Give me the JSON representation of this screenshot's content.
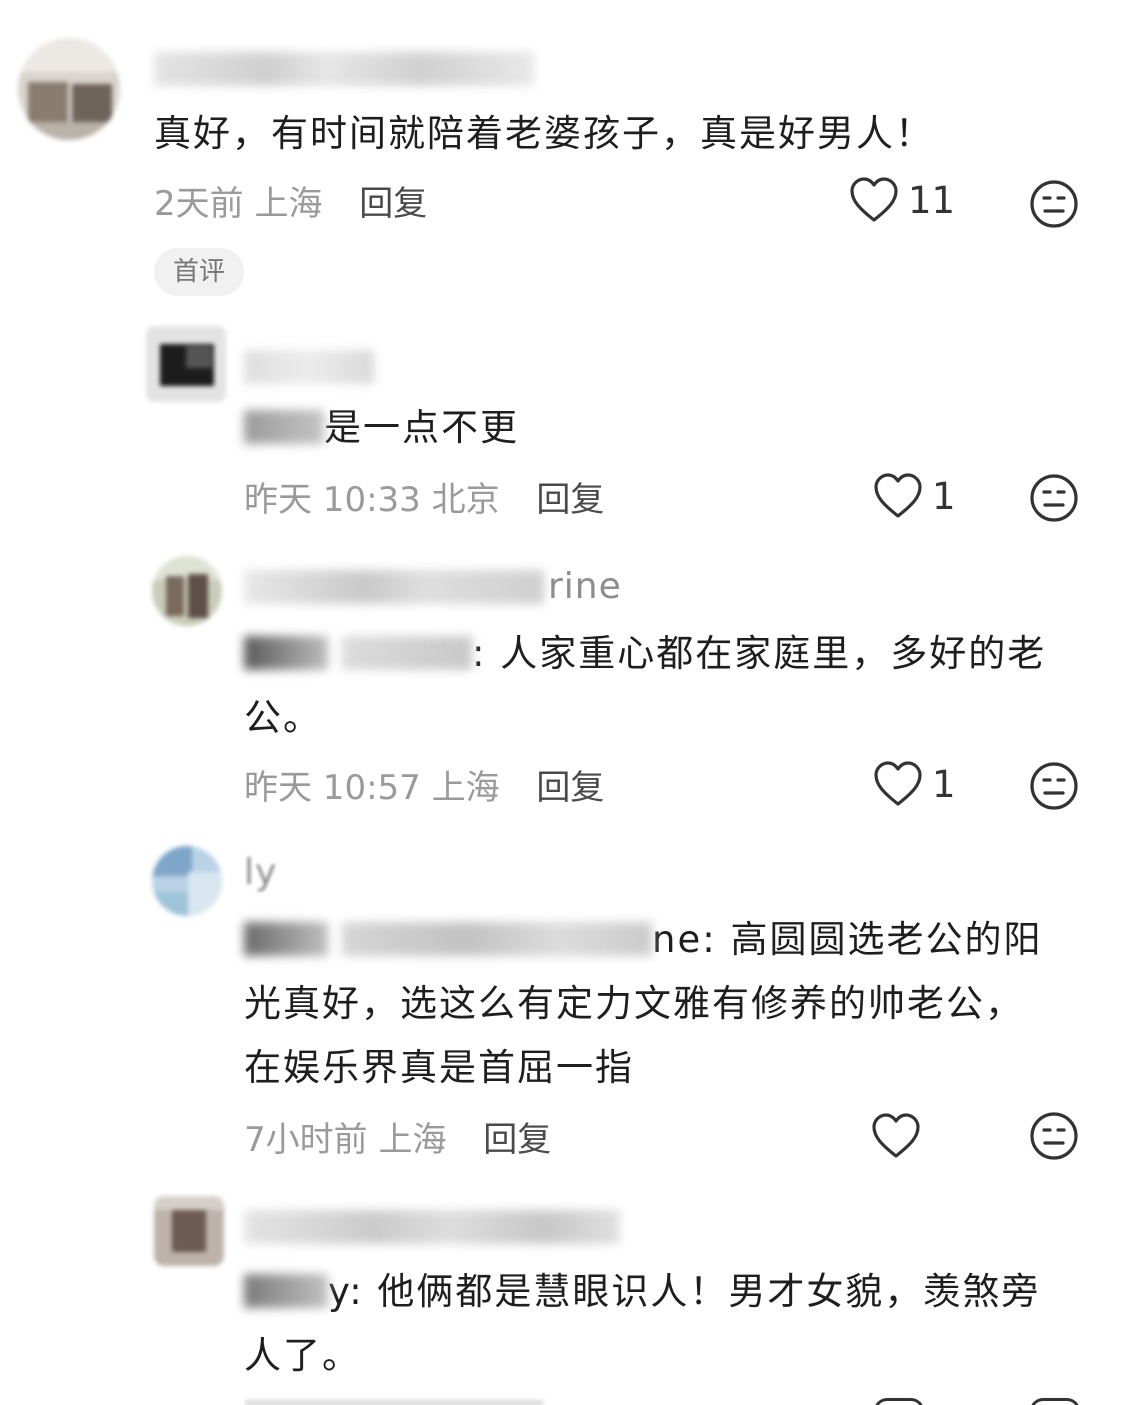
{
  "comments": [
    {
      "text": "真好，有时间就陪着老婆孩子，真是好男人！",
      "time": "2天前",
      "location": "上海",
      "reply_label": "回复",
      "likes": "11",
      "badge": "首评"
    },
    {
      "text_suffix": "是一点不更",
      "time": "昨天 10:33",
      "location": "北京",
      "reply_label": "回复",
      "likes": "1"
    },
    {
      "name_suffix": "rine",
      "text_line1": ": 人家重心都在家庭里，多好的老",
      "text_line2": "公。",
      "time": "昨天 10:57",
      "location": "上海",
      "reply_label": "回复",
      "likes": "1"
    },
    {
      "name_prefix": "ly",
      "text_line1_tail": "ne: 高圆圆选老公的阳",
      "text_line2": "光真好，选这么有定力文雅有修养的帅老公，",
      "text_line3": "在娱乐界真是首屈一指",
      "time": "7小时前",
      "location": "上海",
      "reply_label": "回复",
      "likes": ""
    },
    {
      "text_line1_tail": "y: 他俩都是慧眼识人！男才女貌，羡煞旁",
      "text_line2": "人了。"
    }
  ],
  "colors": {
    "meta": "#9a9a9a",
    "text": "#1e1e1e",
    "badge_bg": "#f1f1f1"
  },
  "icons": [
    "heart-outline-icon",
    "meh-face-icon"
  ]
}
